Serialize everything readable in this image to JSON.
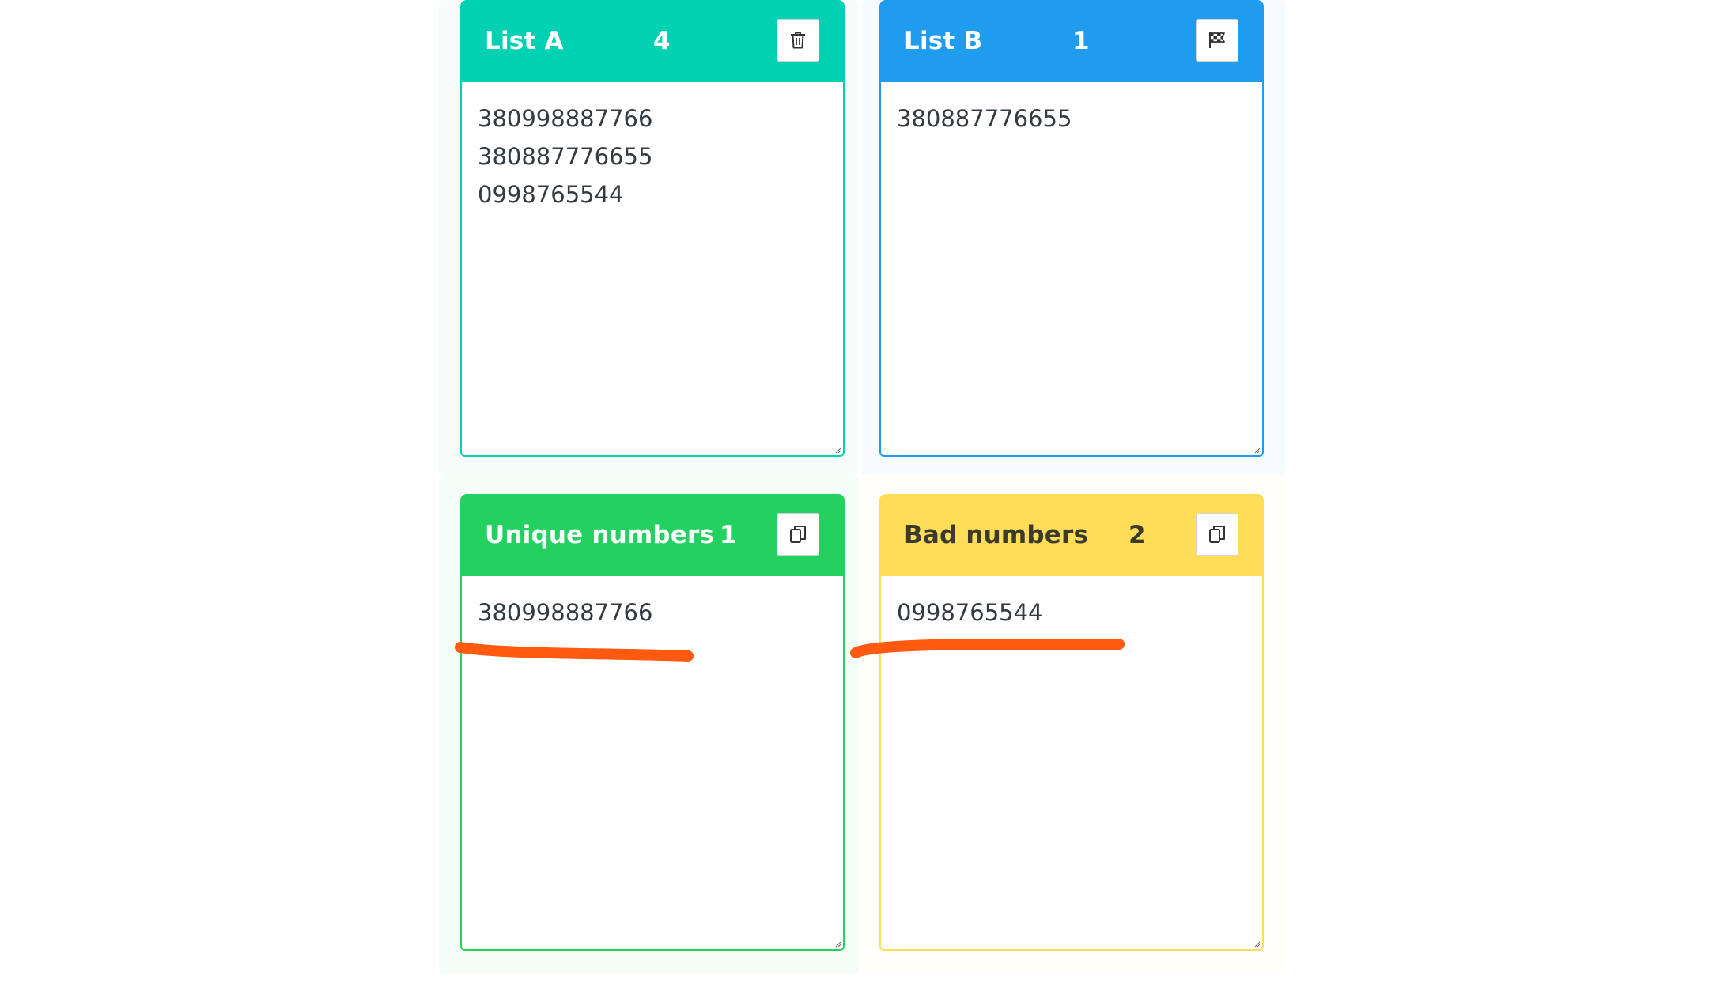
{
  "colors": {
    "list_a": "#00d1b2",
    "list_b": "#209cee",
    "unique": "#23d160",
    "bad": "#ffdd57",
    "annotation": "#ff5a10"
  },
  "panels": {
    "list_a": {
      "title": "List A",
      "count": "4",
      "button_icon": "trash-icon",
      "content": "380998887766\n380887776655\n0998765544"
    },
    "list_b": {
      "title": "List B",
      "count": "1",
      "button_icon": "checkered-flag-icon",
      "content": "380887776655"
    },
    "unique": {
      "title": "Unique numbers",
      "count": "1",
      "button_icon": "copy-icon",
      "content": "380998887766"
    },
    "bad": {
      "title": "Bad numbers",
      "count": "2",
      "button_icon": "copy-icon",
      "content": "0998765544"
    }
  }
}
